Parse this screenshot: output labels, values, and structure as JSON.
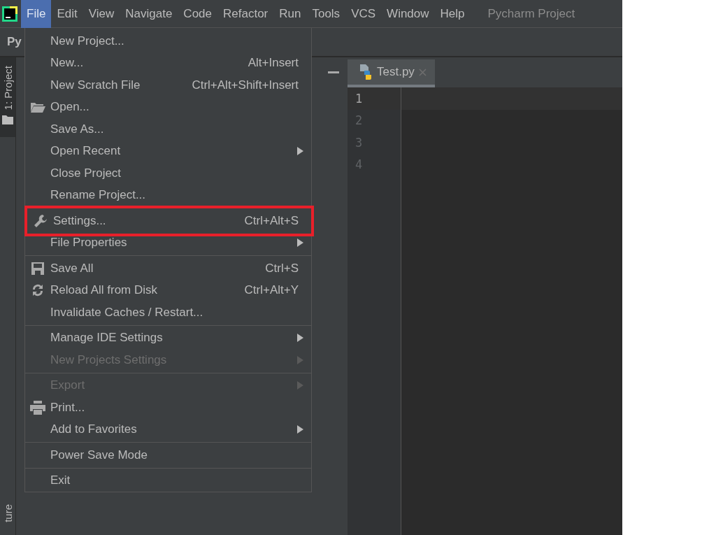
{
  "menu_bar": {
    "items": [
      {
        "label": "File",
        "selected": true
      },
      {
        "label": "Edit",
        "selected": false
      },
      {
        "label": "View",
        "selected": false
      },
      {
        "label": "Navigate",
        "selected": false
      },
      {
        "label": "Code",
        "selected": false
      },
      {
        "label": "Refactor",
        "selected": false
      },
      {
        "label": "Run",
        "selected": false
      },
      {
        "label": "Tools",
        "selected": false
      },
      {
        "label": "VCS",
        "selected": false
      },
      {
        "label": "Window",
        "selected": false
      },
      {
        "label": "Help",
        "selected": false
      }
    ],
    "title": "Pycharm Project"
  },
  "toolbar": {
    "project_name": "Py"
  },
  "left_strip": {
    "tabs": [
      {
        "label": "1: Project",
        "selected": true
      },
      {
        "label": "ture",
        "selected": false
      }
    ]
  },
  "editor": {
    "tabs": [
      {
        "label": "Test.py",
        "selected": true
      }
    ],
    "line_numbers": [
      {
        "label": "1",
        "selected": true
      },
      {
        "label": "2",
        "selected": false
      },
      {
        "label": "3",
        "selected": false
      },
      {
        "label": "4",
        "selected": false
      }
    ]
  },
  "file_menu": {
    "sections": [
      [
        {
          "label": "New Project...",
          "submenu": false,
          "disabled": false,
          "highlighted": false
        },
        {
          "label": "New...",
          "shortcut": "Alt+Insert",
          "submenu": false,
          "disabled": false,
          "highlighted": false
        },
        {
          "label": "New Scratch File",
          "shortcut": "Ctrl+Alt+Shift+Insert",
          "submenu": false,
          "disabled": false,
          "highlighted": false
        },
        {
          "label": "Open...",
          "submenu": false,
          "disabled": false,
          "highlighted": false
        },
        {
          "label": "Save As...",
          "submenu": false,
          "disabled": false,
          "highlighted": false
        },
        {
          "label": "Open Recent",
          "submenu": true,
          "disabled": false,
          "highlighted": false
        },
        {
          "label": "Close Project",
          "submenu": false,
          "disabled": false,
          "highlighted": false
        },
        {
          "label": "Rename Project...",
          "submenu": false,
          "disabled": false,
          "highlighted": false
        }
      ],
      [
        {
          "label": "Settings...",
          "shortcut": "Ctrl+Alt+S",
          "submenu": false,
          "disabled": false,
          "highlighted": true
        },
        {
          "label": "File Properties",
          "submenu": true,
          "disabled": false,
          "highlighted": false
        }
      ],
      [
        {
          "label": "Save All",
          "shortcut": "Ctrl+S",
          "submenu": false,
          "disabled": false,
          "highlighted": false
        },
        {
          "label": "Reload All from Disk",
          "shortcut": "Ctrl+Alt+Y",
          "submenu": false,
          "disabled": false,
          "highlighted": false
        },
        {
          "label": "Invalidate Caches / Restart...",
          "submenu": false,
          "disabled": false,
          "highlighted": false
        }
      ],
      [
        {
          "label": "Manage IDE Settings",
          "submenu": true,
          "disabled": false,
          "highlighted": false
        },
        {
          "label": "New Projects Settings",
          "submenu": true,
          "disabled": true,
          "highlighted": false
        }
      ],
      [
        {
          "label": "Export",
          "submenu": true,
          "disabled": true,
          "highlighted": false
        },
        {
          "label": "Print...",
          "submenu": false,
          "disabled": false,
          "highlighted": false
        },
        {
          "label": "Add to Favorites",
          "submenu": true,
          "disabled": false,
          "highlighted": false
        }
      ],
      [
        {
          "label": "Power Save Mode",
          "submenu": false,
          "disabled": false,
          "highlighted": false
        }
      ],
      [
        {
          "label": "Exit",
          "submenu": false,
          "disabled": false,
          "highlighted": false
        }
      ]
    ]
  }
}
